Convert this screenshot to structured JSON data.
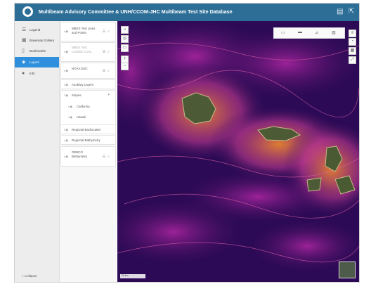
{
  "header": {
    "title": "Multibeam Advisory Committee & UNH/CCOM-JHC Multibeam Test Site Database",
    "icon_left": "document-icon",
    "icon_right": "share-icon"
  },
  "sidebar": {
    "items": [
      {
        "label": "Legend",
        "icon": "legend-icon"
      },
      {
        "label": "Basemap Gallery",
        "icon": "grid-icon"
      },
      {
        "label": "Bookmarks",
        "icon": "bookmark-icon"
      },
      {
        "label": "Layers",
        "icon": "layers-icon"
      },
      {
        "label": "Info",
        "icon": "info-icon"
      }
    ],
    "collapse_label": "Collapse"
  },
  "layers": {
    "l0": "MBES Test Lines and Points",
    "l1": "MBES Test Location Cont...",
    "l2": "NOAA ENC",
    "l3": "Auxiliary Layers",
    "l4": "Slopes",
    "l4a": "California",
    "l4b": "Hawaii",
    "l5": "Regional Backscatter",
    "l6": "Regional Bathymetry",
    "l7": "GEBCO Bathymetry"
  },
  "map": {
    "scale_label": "20 km"
  },
  "colors": {
    "header": "#2d6e97",
    "active_nav": "#2f8fdc",
    "map_dark": "#2c0a55",
    "map_glow": "#e8822a",
    "map_magenta": "#b928a8"
  }
}
